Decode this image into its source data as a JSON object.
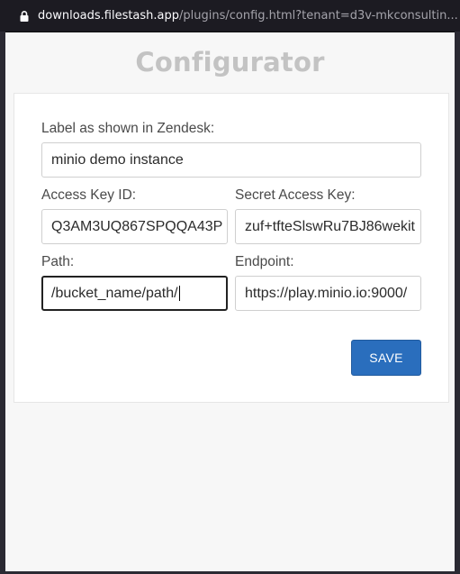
{
  "browser": {
    "url_host": "downloads.filestash.app",
    "url_path": "/plugins/config.html?tenant=d3v-mkconsultin..."
  },
  "page": {
    "title": "Configurator"
  },
  "form": {
    "label_field": {
      "label": "Label as shown in Zendesk:",
      "value": "minio demo instance"
    },
    "access_key": {
      "label": "Access Key ID:",
      "value": "Q3AM3UQ867SPQQA43P"
    },
    "secret_key": {
      "label": "Secret Access Key:",
      "value": "zuf+tfteSlswRu7BJ86wekit"
    },
    "path": {
      "label": "Path:",
      "value": "/bucket_name/path/"
    },
    "endpoint": {
      "label": "Endpoint:",
      "value": "https://play.minio.io:9000/"
    },
    "save_label": "SAVE"
  },
  "icons": {
    "lock": "lock-icon"
  },
  "colors": {
    "accent": "#2a6ebd",
    "title": "#c3c3c3",
    "chrome": "#1c1b22"
  }
}
